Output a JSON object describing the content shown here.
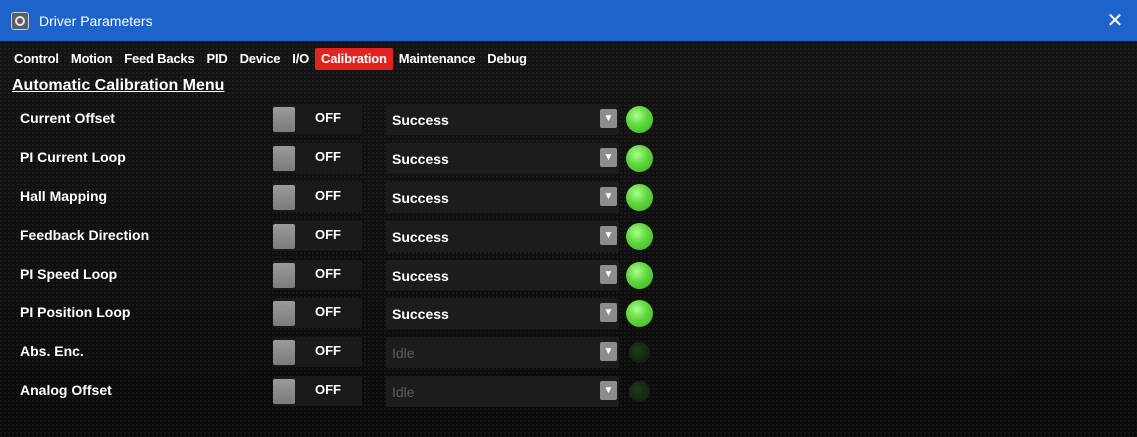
{
  "window": {
    "title": "Driver Parameters",
    "close_glyph": "✕"
  },
  "tabs": [
    {
      "label": "Control"
    },
    {
      "label": "Motion"
    },
    {
      "label": "Feed Backs"
    },
    {
      "label": "PID"
    },
    {
      "label": "Device"
    },
    {
      "label": "I/O"
    },
    {
      "label": "Calibration",
      "active": true
    },
    {
      "label": "Maintenance"
    },
    {
      "label": "Debug"
    }
  ],
  "menu_title": "Automatic Calibration Menu",
  "rows": [
    {
      "label": "Current Offset",
      "toggle": "OFF",
      "status": "Success",
      "led": "on"
    },
    {
      "label": "PI Current Loop",
      "toggle": "OFF",
      "status": "Success",
      "led": "on"
    },
    {
      "label": "Hall Mapping",
      "toggle": "OFF",
      "status": "Success",
      "led": "on"
    },
    {
      "label": "Feedback Direction",
      "toggle": "OFF",
      "status": "Success",
      "led": "on"
    },
    {
      "label": "PI Speed Loop",
      "toggle": "OFF",
      "status": "Success",
      "led": "on"
    },
    {
      "label": "PI Position Loop",
      "toggle": "OFF",
      "status": "Success",
      "led": "on"
    },
    {
      "label": "Abs. Enc.",
      "toggle": "OFF",
      "status": "Idle",
      "led": "off"
    },
    {
      "label": "Analog Offset",
      "toggle": "OFF",
      "status": "Idle",
      "led": "off"
    }
  ],
  "colors": {
    "titlebar": "#1e63c9",
    "active_tab": "#e32222",
    "led_on": "#5fd53d"
  }
}
